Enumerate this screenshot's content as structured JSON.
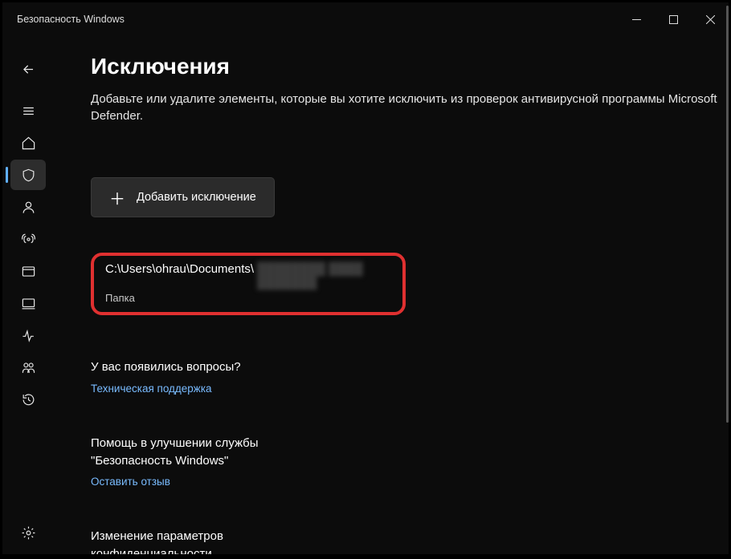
{
  "titlebar": {
    "title": "Безопасность Windows"
  },
  "page": {
    "heading": "Исключения",
    "description": "Добавьте или удалите элементы, которые вы хотите исключить из проверок антивирусной программы Microsoft Defender."
  },
  "actions": {
    "add_label": "Добавить исключение"
  },
  "exclusions": [
    {
      "path_visible": "C:\\Users\\ohrau\\Documents\\",
      "path_redacted": "████████ ████ ███████",
      "type": "Папка"
    }
  ],
  "sections": {
    "questions_heading": "У вас появились вопросы?",
    "questions_link": "Техническая поддержка",
    "improve_heading": "Помощь в улучшении службы \"Безопасность Windows\"",
    "improve_link": "Оставить отзыв",
    "privacy_heading": "Изменение параметров конфиденциальности"
  },
  "sidebar": {
    "items": [
      "back",
      "menu",
      "home",
      "shield",
      "account",
      "firewall",
      "appbrowser",
      "device",
      "performance",
      "family",
      "history"
    ]
  }
}
